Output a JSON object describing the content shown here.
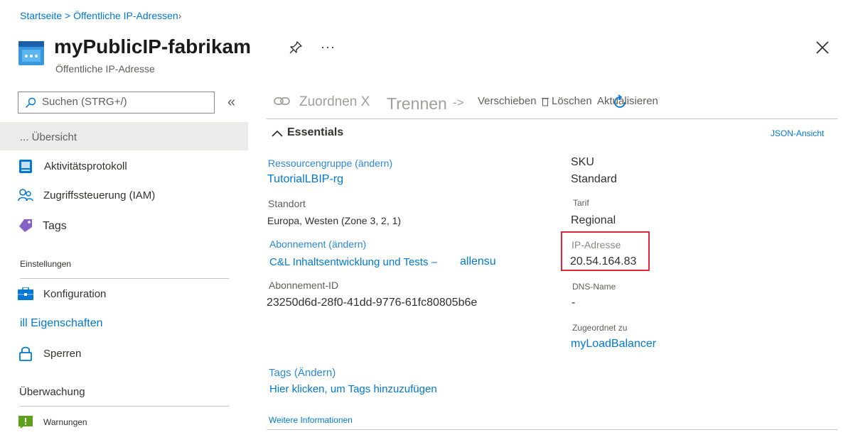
{
  "breadcrumb": {
    "home": "Startseite",
    "separator": " > ",
    "current": "Öffentliche IP-Adressen",
    "chevron": "›"
  },
  "header": {
    "title": "myPublicIP-fabrikam",
    "subtitle": "Öffentliche IP-Adresse",
    "more": "···"
  },
  "sidebar": {
    "search_placeholder": "Suchen (STRG+/)",
    "collapse": "«",
    "items": [
      {
        "label": "... Übersicht",
        "icon": "overview-icon"
      },
      {
        "label": "Aktivitätsprotokoll",
        "icon": "activity-log-icon"
      },
      {
        "label": "Zugriffssteuerung (IAM)",
        "icon": "people-icon"
      },
      {
        "label": "Tags",
        "icon": "tag-icon"
      }
    ],
    "section_settings": "Einstellungen",
    "settings_items": [
      {
        "label": "Konfiguration",
        "icon": "toolbox-icon"
      },
      {
        "label": "ill Eigenschaften",
        "icon": "properties-icon"
      },
      {
        "label": "Sperren",
        "icon": "lock-icon"
      }
    ],
    "section_monitoring": "Überwachung",
    "monitoring_items": [
      {
        "label": "Warnungen",
        "icon": "alert-icon"
      }
    ]
  },
  "commandbar": {
    "associate": "Zuordnen X",
    "dissociate": "Trennen",
    "dissociate_arrow": "->",
    "move": "Verschieben",
    "delete": "Löschen",
    "refresh": "Aktualisieren"
  },
  "essentials": {
    "header": "Essentials",
    "json_view": "JSON-Ansicht",
    "left": {
      "rg_label": "Ressourcengruppe (ändern)",
      "rg_value": "TutorialLBIP-rg",
      "location_label": "Standort",
      "location_value": "Europa, Westen (Zone 3, 2, 1)",
      "subscription_label": "Abonnement (ändern)",
      "subscription_value": "C&L Inhaltsentwicklung und Tests –",
      "subscription_user": "allensu",
      "subscription_id_label": "Abonnement-ID",
      "subscription_id_value": "23250d6d-28f0-41dd-9776-61fc80805b6e"
    },
    "right": {
      "sku_label": "SKU",
      "sku_value": "Standard",
      "tier_label": "Tarif",
      "tier_value": "Regional",
      "ip_label": "IP-Adresse",
      "ip_value": "20.54.164.83",
      "dns_label": "DNS-Name",
      "dns_value": "-",
      "assoc_label": "Zugeordnet zu",
      "assoc_value": "myLoadBalancer"
    },
    "tags_label": "Tags (Ändern)",
    "tags_link": "Hier klicken, um Tags hinzuzufügen",
    "more_info": "Weitere Informationen"
  },
  "colors": {
    "accent": "#0078d4",
    "highlight": "#e3243b",
    "selected_bg": "#edebe9"
  }
}
